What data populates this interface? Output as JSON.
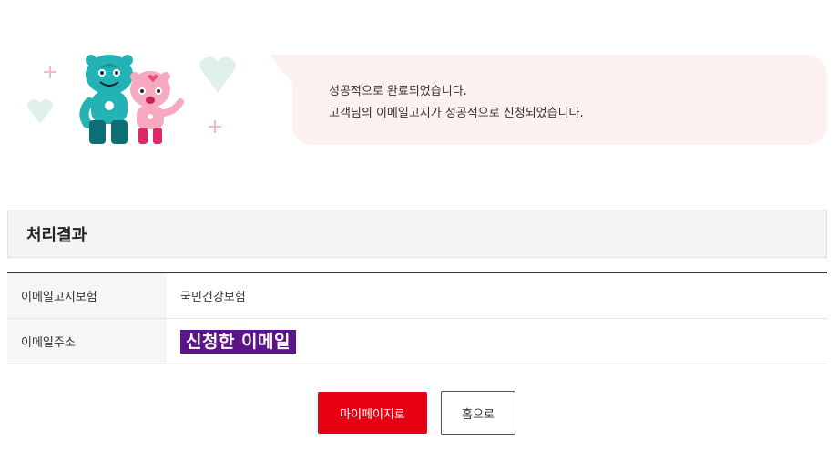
{
  "message": {
    "line1": "성공적으로 완료되었습니다.",
    "line2": "고객님의 이메일고지가 성공적으로 신청되었습니다."
  },
  "section": {
    "title": "처리결과"
  },
  "result": {
    "rows": [
      {
        "label": "이메일고지보험",
        "value": "국민건강보험"
      },
      {
        "label": "이메일주소",
        "value": "신청한 이메일"
      }
    ]
  },
  "buttons": {
    "mypage": "마이페이지로",
    "home": "홈으로"
  },
  "colors": {
    "accent": "#e60012",
    "speech_bg": "#fdf0f0",
    "redact_bg": "#5b1588",
    "mascot_teal": "#23b3b5",
    "mascot_pink": "#f6a9bf"
  },
  "icons": [
    "mascot-illustration",
    "heart-decoration",
    "sparkle-decoration"
  ]
}
